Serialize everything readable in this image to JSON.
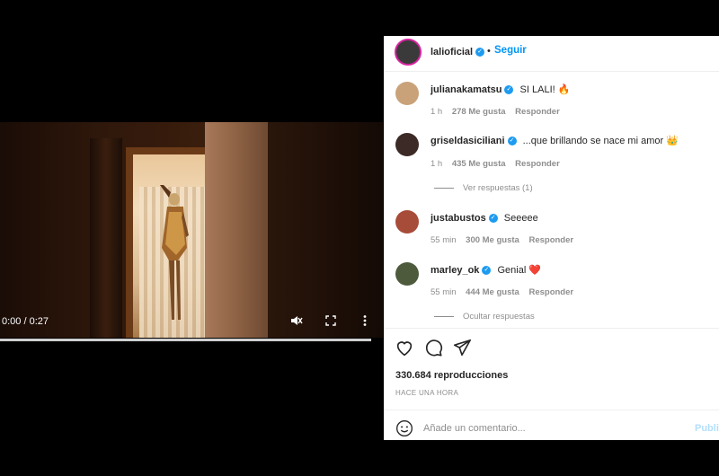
{
  "video": {
    "time": "0:00 / 0:27",
    "controls": {
      "mute_icon": "muted-speaker-icon",
      "fullscreen_icon": "fullscreen-icon",
      "more_icon": "vertical-dots-icon"
    },
    "progress": 0
  },
  "post": {
    "author": "lalioficial",
    "follow_label": "Seguir",
    "views": "330.684 reproducciones",
    "time_ago": "HACE UNA HORA",
    "comment_placeholder": "Añade un comentario...",
    "publish_label": "Publi"
  },
  "comments": [
    {
      "user": "julianakamatsu",
      "text": "SI LALI! 🔥",
      "time": "1 h",
      "likes": "278 Me gusta",
      "reply": "Responder"
    },
    {
      "user": "griseldasiciliani",
      "text": "...que brillando se nace mi amor 👑",
      "time": "1 h",
      "likes": "435 Me gusta",
      "reply": "Responder",
      "view_replies": "Ver respuestas (1)"
    },
    {
      "user": "justabustos",
      "text": "Seeeee",
      "time": "55 min",
      "likes": "300 Me gusta",
      "reply": "Responder"
    },
    {
      "user": "marley_ok",
      "text": "Genial ❤️",
      "time": "55 min",
      "likes": "444 Me gusta",
      "reply": "Responder",
      "hide_replies": "Ocultar respuestas"
    }
  ],
  "colors": {
    "accent": "#0095f6",
    "verified": "#1d9bf0",
    "muted": "#8e8e8e"
  }
}
